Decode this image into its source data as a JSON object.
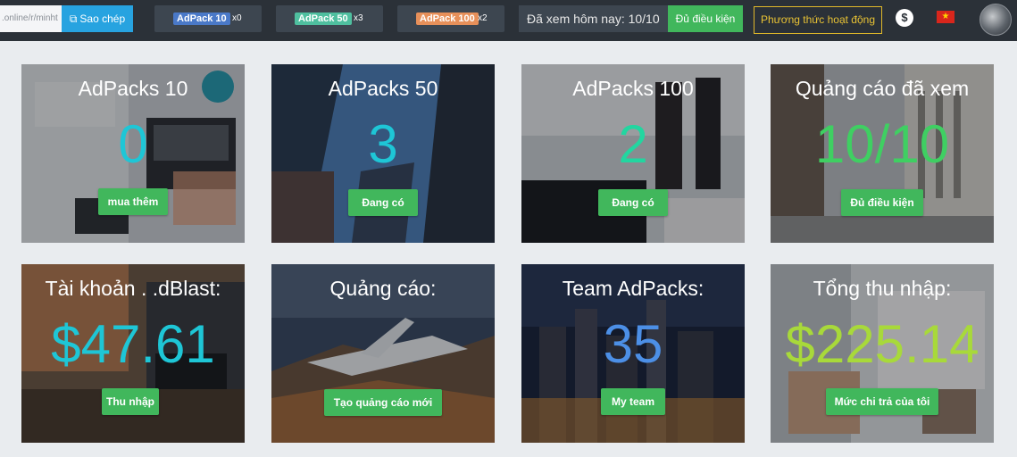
{
  "topbar": {
    "ref_link_value": ".online/r/minht",
    "copy_label": "Sao chép",
    "packs": [
      {
        "label": "AdPack 10",
        "count": "x0",
        "color": "#4a79c8"
      },
      {
        "label": "AdPack 50",
        "count": "x3",
        "color": "#4fbf9f"
      },
      {
        "label": "AdPack 100",
        "count": "x2",
        "color": "#e7905a"
      }
    ],
    "viewed_text": "Đã xem hôm nay: 10/10",
    "eligible_label": "Đủ điều kiện",
    "how_it_works": "Phương thức hoạt động",
    "dollar_icon": "$",
    "flag_icon": "vietnam-flag-icon",
    "avatar_icon": "user-avatar"
  },
  "cards": [
    {
      "title": "AdPacks 10",
      "value": "0",
      "value_color": "#1ec6d6",
      "button": "mua thêm",
      "bg": "office-desk-laptop"
    },
    {
      "title": "AdPacks 50",
      "value": "3",
      "value_color": "#1ec6d6",
      "button": "Đang có",
      "bg": "skyscrapers-sky"
    },
    {
      "title": "AdPacks 100",
      "value": "2",
      "value_color": "#22d6a0",
      "button": "Đang có",
      "bg": "business-people-office"
    },
    {
      "title": "Quảng cáo đã xem",
      "value": "10/10",
      "value_color": "#3fcf62",
      "button": "Đủ điều kiện",
      "bg": "city-street-buildings"
    },
    {
      "title": "Tài khoản . .dBlast:",
      "value": "$47.61",
      "value_color": "#1ec6d6",
      "button": "Thu nhập",
      "bg": "hands-phone-laptop"
    },
    {
      "title": "Quảng cáo:",
      "value": "",
      "value_color": "#ffffff",
      "button": "Tạo quảng cáo mới",
      "bg": "jet-over-mountains"
    },
    {
      "title": "Team AdPacks:",
      "value": "35",
      "value_color": "#4c8fe6",
      "button": "My team",
      "bg": "night-city-skyline"
    },
    {
      "title": "Tổng thu nhập:",
      "value": "$225.14",
      "value_color": "#a8d93a",
      "button": "Mức chi trả của tôi",
      "bg": "hands-documents"
    }
  ]
}
